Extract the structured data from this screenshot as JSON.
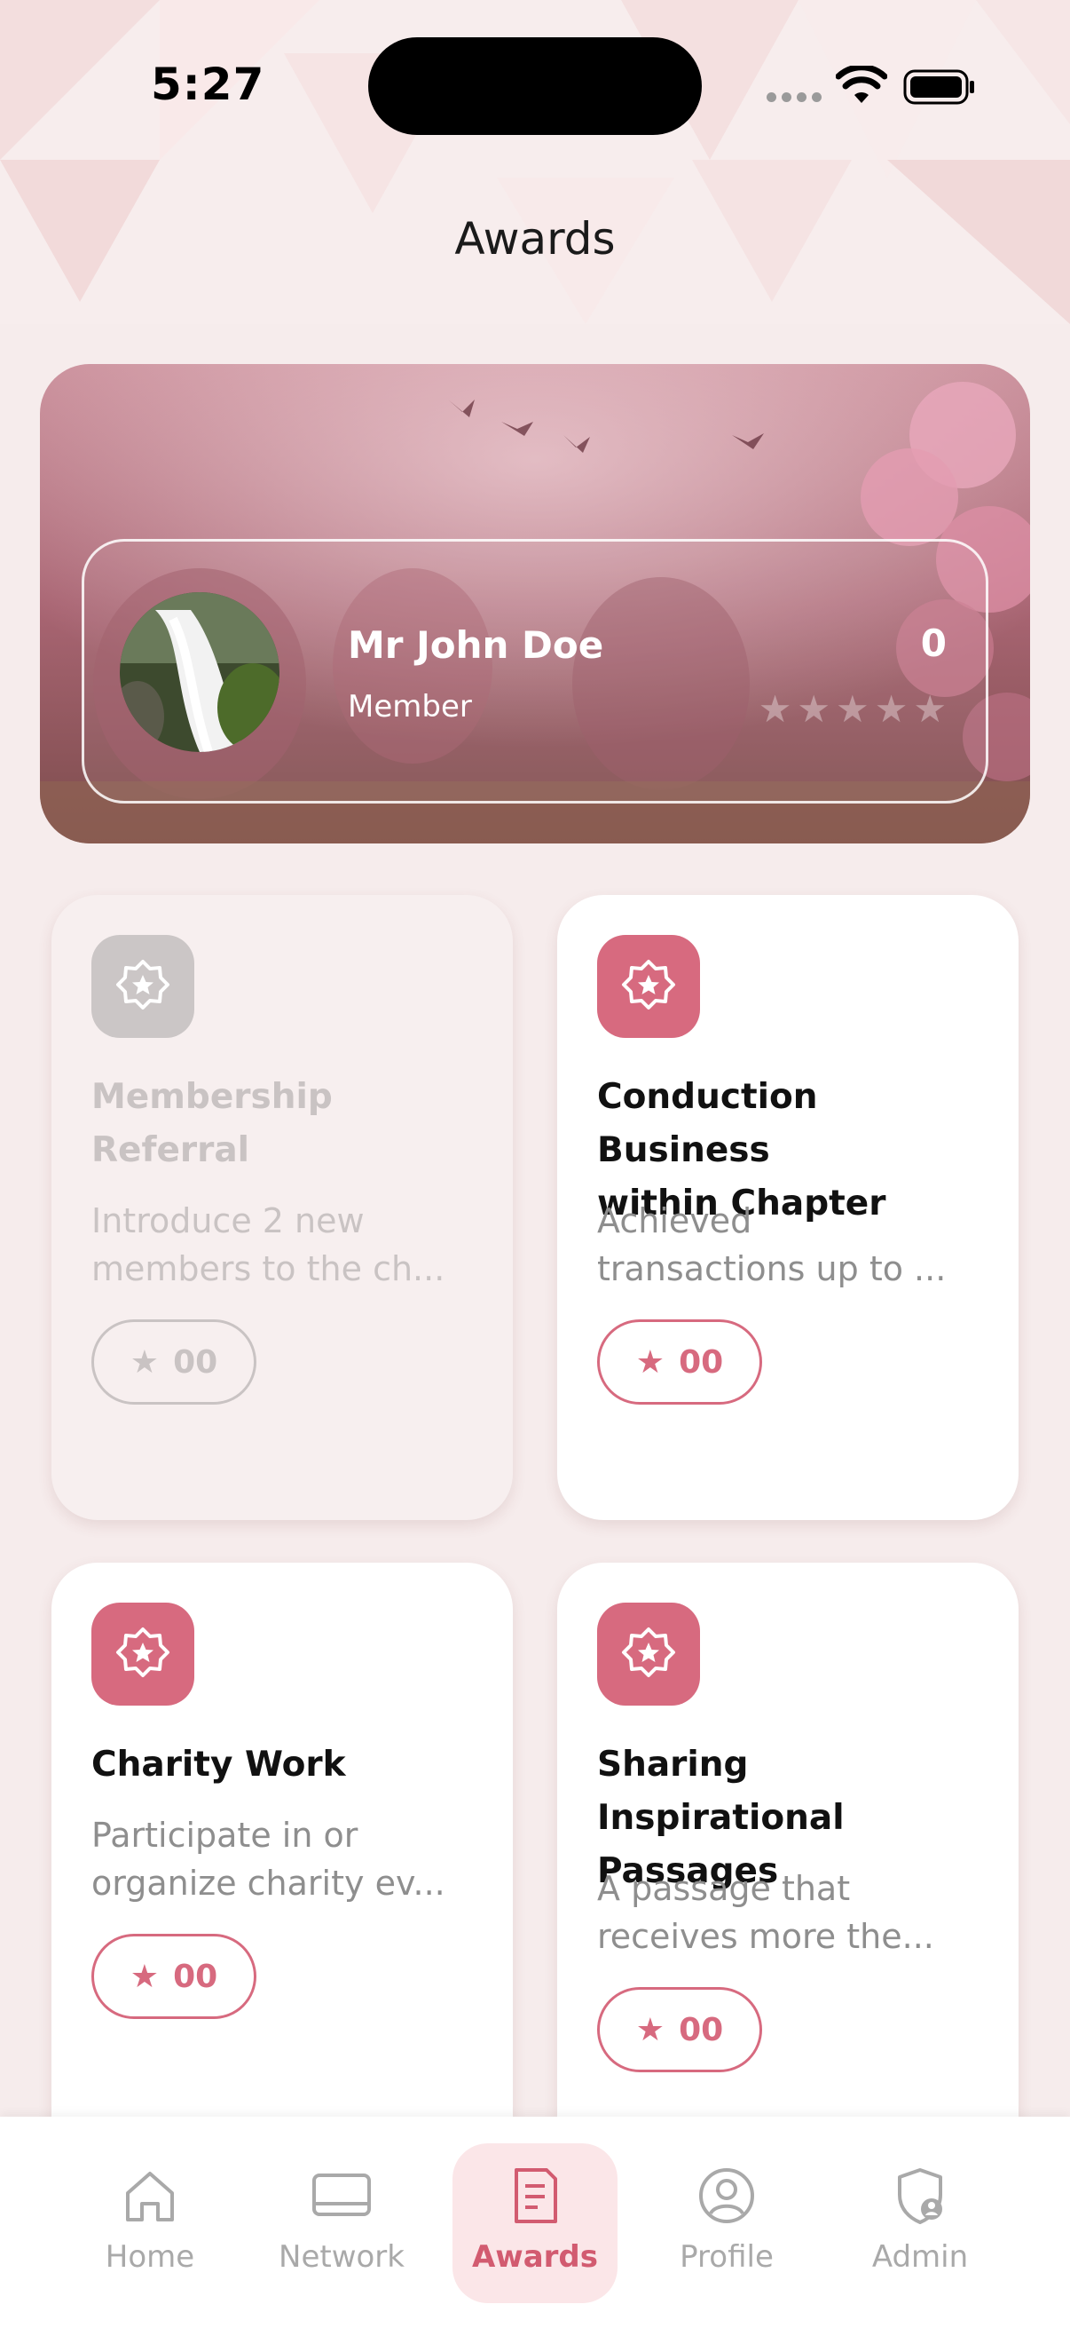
{
  "status_bar": {
    "time": "5:27"
  },
  "header": {
    "title": "Awards"
  },
  "profile": {
    "name": "Mr John Doe",
    "role": "Member",
    "score": "0",
    "rating": 0,
    "max_rating": 5
  },
  "awards": [
    {
      "title_lines": [
        "Membership",
        "Referral"
      ],
      "desc_lines": [
        "Introduce 2 new",
        "members to the ch..."
      ],
      "points": "00",
      "enabled": false
    },
    {
      "title_lines": [
        "Conduction Business",
        "within Chapter"
      ],
      "desc_lines": [
        "Achieved",
        "transactions up to ..."
      ],
      "points": "00",
      "enabled": true
    },
    {
      "title_lines": [
        "Charity Work"
      ],
      "desc_lines": [
        "Participate in or",
        "organize charity ev..."
      ],
      "points": "00",
      "enabled": true
    },
    {
      "title_lines": [
        "Sharing Inspirational",
        "Passages"
      ],
      "desc_lines": [
        "A passage that",
        "receives more the..."
      ],
      "points": "00",
      "enabled": true
    }
  ],
  "nav": {
    "items": [
      {
        "label": "Home",
        "icon": "home-icon"
      },
      {
        "label": "Network",
        "icon": "network-icon"
      },
      {
        "label": "Awards",
        "icon": "awards-icon",
        "active": true
      },
      {
        "label": "Profile",
        "icon": "profile-icon"
      },
      {
        "label": "Admin",
        "icon": "admin-icon"
      }
    ]
  },
  "colors": {
    "accent": "#d76a7f",
    "disabled": "#c9c3c3",
    "background": "#f6ecec"
  }
}
